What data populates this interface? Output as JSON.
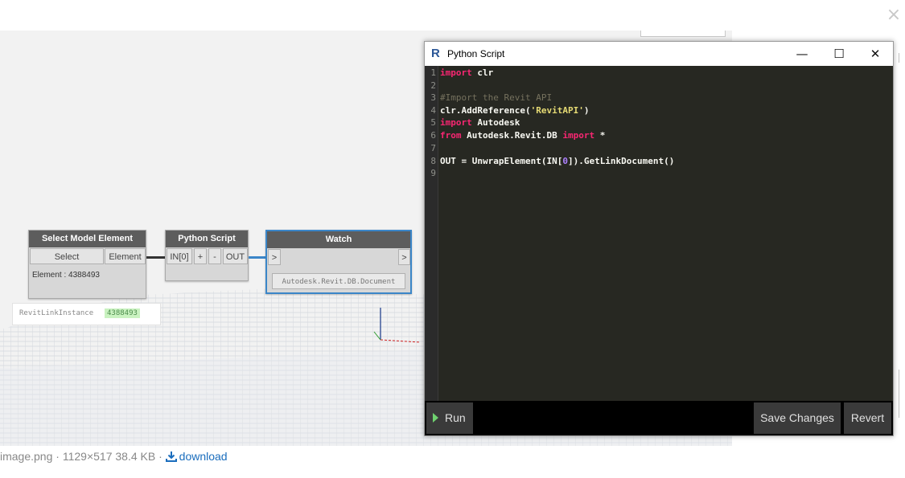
{
  "lightbox": {
    "close_glyph": "×"
  },
  "caption": {
    "filename": "image.png",
    "separator": "·",
    "dimensions": "1129×517",
    "size": "38.4 KB",
    "download_label": "download"
  },
  "nodes": {
    "select_model_element": {
      "title": "Select Model Element",
      "select_label": "Select",
      "output_port": "Element",
      "info": "Element : 4388493"
    },
    "python_script": {
      "title": "Python Script",
      "input_port": "IN[0]",
      "add_label": "+",
      "remove_label": "-",
      "output_port": "OUT"
    },
    "watch": {
      "title": "Watch",
      "input_port": ">",
      "output_port": ">",
      "value": "Autodesk.Revit.DB.Document"
    }
  },
  "preview": {
    "label": "RevitLinkInstance",
    "value": "4388493"
  },
  "editor": {
    "logo": "R",
    "title": "Python Script",
    "minimize_glyph": "—",
    "maximize_glyph": "☐",
    "close_glyph": "✕",
    "line_numbers": [
      "1",
      "2",
      "3",
      "4",
      "5",
      "6",
      "7",
      "8",
      "9"
    ],
    "code": {
      "l1_kw": "import",
      "l1_rest": " clr",
      "l3_comment": "#Import the Revit API",
      "l4_a": "clr.AddReference(",
      "l4_str": "'RevitAPI'",
      "l4_b": ")",
      "l5_kw": "import",
      "l5_rest": " Autodesk",
      "l6_kw": "from",
      "l6_mid": " Autodesk.Revit.DB ",
      "l6_kw2": "import",
      "l6_rest": " *",
      "l8_a": "OUT = UnwrapElement(IN[",
      "l8_num": "0",
      "l8_b": "]).GetLinkDocument()"
    },
    "run_label": "Run",
    "save_label": "Save Changes",
    "revert_label": "Revert"
  },
  "colors": {
    "editor_bg": "#272822",
    "keyword": "#f92672",
    "string": "#e6db74",
    "comment": "#75715e",
    "number": "#ae81ff",
    "link": "#1a6dbd"
  }
}
